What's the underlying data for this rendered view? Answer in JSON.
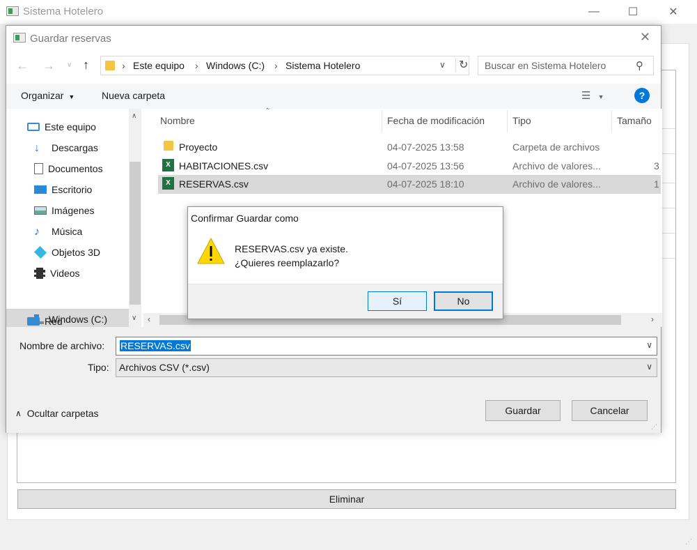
{
  "app": {
    "title": "Sistema Hotelero",
    "eliminar": "Eliminar"
  },
  "dialog": {
    "title": "Guardar reservas",
    "breadcrumb": [
      "Este equipo",
      "Windows (C:)",
      "Sistema Hotelero"
    ],
    "search_placeholder": "Buscar en Sistema Hotelero",
    "toolbar": {
      "organize": "Organizar",
      "new_folder": "Nueva carpeta"
    },
    "nav_items": [
      "Este equipo",
      "Descargas",
      "Documentos",
      "Escritorio",
      "Imágenes",
      "Música",
      "Objetos 3D",
      "Videos",
      "Windows (C:)",
      "Red"
    ],
    "columns": {
      "name": "Nombre",
      "date": "Fecha de modificación",
      "type": "Tipo",
      "size": "Tamaño"
    },
    "files": [
      {
        "name": "Proyecto",
        "date": "04-07-2025 13:58",
        "type": "Carpeta de archivos",
        "size": ""
      },
      {
        "name": "HABITACIONES.csv",
        "date": "04-07-2025 13:56",
        "type": "Archivo de valores...",
        "size": "3"
      },
      {
        "name": "RESERVAS.csv",
        "date": "04-07-2025 18:10",
        "type": "Archivo de valores...",
        "size": "1"
      }
    ],
    "filename_label": "Nombre de archivo:",
    "filename_value": "RESERVAS.csv",
    "type_label": "Tipo:",
    "type_value": "Archivos CSV (*.csv)",
    "hide_folders": "Ocultar carpetas",
    "save": "Guardar",
    "cancel": "Cancelar"
  },
  "confirm": {
    "title": "Confirmar Guardar como",
    "line1": "RESERVAS.csv ya existe.",
    "line2": "¿Quieres reemplazarlo?",
    "yes": "Sí",
    "no": "No"
  },
  "colors": {
    "accent": "#0078d7",
    "selection": "#cce8ff",
    "warning": "#ffd700"
  }
}
